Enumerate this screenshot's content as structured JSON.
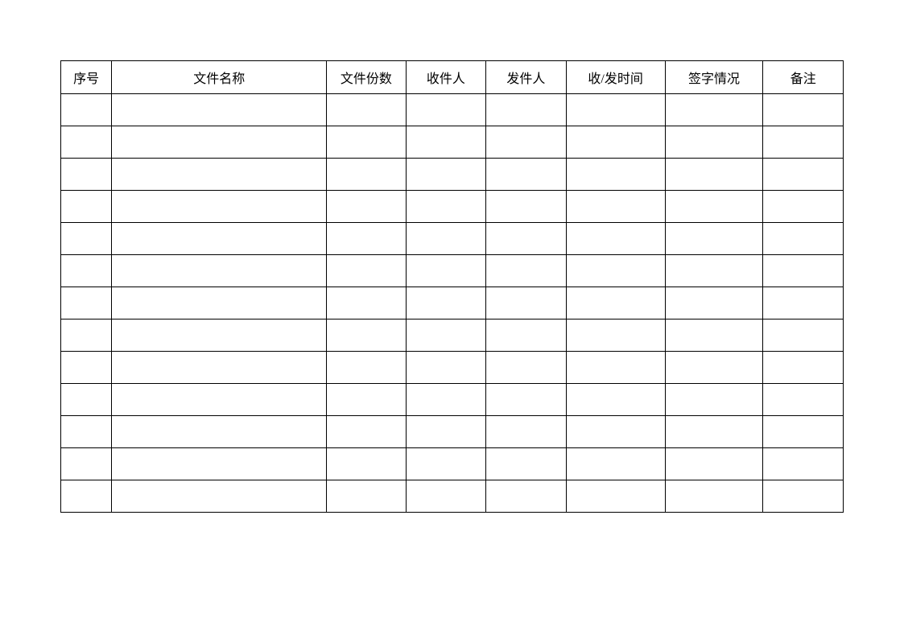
{
  "table": {
    "headers": [
      "序号",
      "文件名称",
      "文件份数",
      "收件人",
      "发件人",
      "收/发时间",
      "签字情况",
      "备注"
    ],
    "rows": [
      [
        "",
        "",
        "",
        "",
        "",
        "",
        "",
        ""
      ],
      [
        "",
        "",
        "",
        "",
        "",
        "",
        "",
        ""
      ],
      [
        "",
        "",
        "",
        "",
        "",
        "",
        "",
        ""
      ],
      [
        "",
        "",
        "",
        "",
        "",
        "",
        "",
        ""
      ],
      [
        "",
        "",
        "",
        "",
        "",
        "",
        "",
        ""
      ],
      [
        "",
        "",
        "",
        "",
        "",
        "",
        "",
        ""
      ],
      [
        "",
        "",
        "",
        "",
        "",
        "",
        "",
        ""
      ],
      [
        "",
        "",
        "",
        "",
        "",
        "",
        "",
        ""
      ],
      [
        "",
        "",
        "",
        "",
        "",
        "",
        "",
        ""
      ],
      [
        "",
        "",
        "",
        "",
        "",
        "",
        "",
        ""
      ],
      [
        "",
        "",
        "",
        "",
        "",
        "",
        "",
        ""
      ],
      [
        "",
        "",
        "",
        "",
        "",
        "",
        "",
        ""
      ],
      [
        "",
        "",
        "",
        "",
        "",
        "",
        "",
        ""
      ]
    ]
  }
}
